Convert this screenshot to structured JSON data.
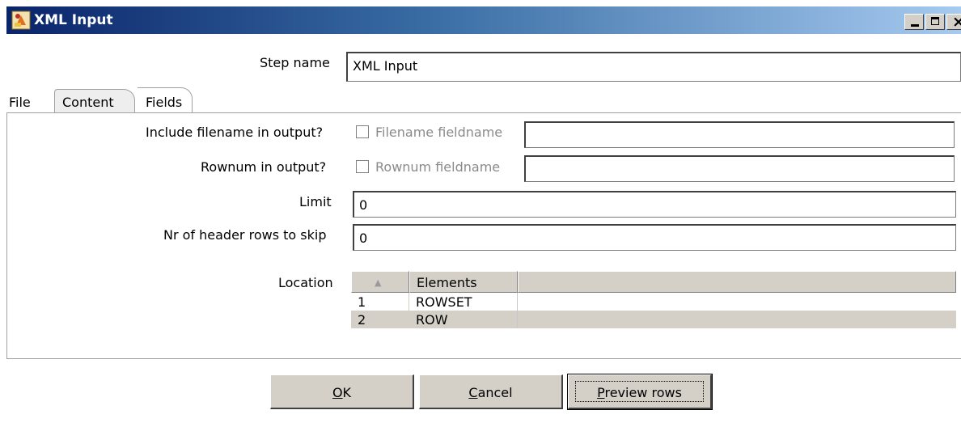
{
  "window": {
    "title": "XML Input",
    "icon": "spoon-app-icon"
  },
  "step": {
    "label": "Step name",
    "value": "XML Input"
  },
  "tabs": [
    {
      "label": "File",
      "active": false
    },
    {
      "label": "Content",
      "active": true
    },
    {
      "label": "Fields",
      "active": false
    }
  ],
  "content": {
    "include_filename_label": "Include filename in output?",
    "filename_field_label": "Filename fieldname",
    "filename_field_value": "",
    "rownum_label": "Rownum in output?",
    "rownum_field_label": "Rownum fieldname",
    "rownum_field_value": "",
    "limit_label": "Limit",
    "limit_value": "0",
    "header_rows_label": "Nr of header rows to skip",
    "header_rows_value": "0",
    "location_label": "Location"
  },
  "location_table": {
    "sort_icon": "▲",
    "columns": [
      "Elements"
    ],
    "rows": [
      {
        "num": "1",
        "element": "ROWSET"
      },
      {
        "num": "2",
        "element": "ROW"
      }
    ]
  },
  "buttons": {
    "ok": {
      "mnemonic": "O",
      "rest": "K"
    },
    "cancel": {
      "mnemonic": "C",
      "rest": "ancel"
    },
    "preview": {
      "mnemonic": "P",
      "rest": "review rows"
    }
  },
  "colors": {
    "titlebar_start": "#0a246a",
    "titlebar_end": "#a6caf0",
    "face": "#d4d0c8"
  }
}
